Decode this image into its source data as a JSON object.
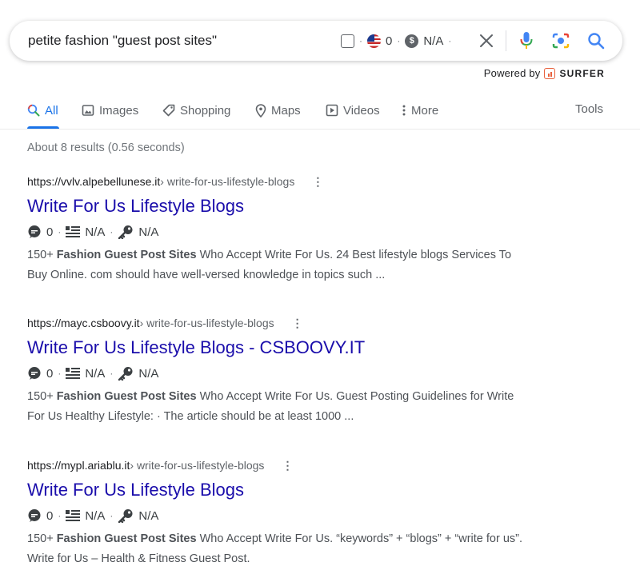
{
  "search": {
    "query": "petite fashion \"guest post sites\"",
    "surfer_count": "0",
    "surfer_cpc": "N/A"
  },
  "powered_by": {
    "label": "Powered by",
    "brand": "SURFER"
  },
  "tabs": [
    {
      "label": "All",
      "icon": "search-icon",
      "active": true
    },
    {
      "label": "Images",
      "icon": "image-icon"
    },
    {
      "label": "Shopping",
      "icon": "tag-icon"
    },
    {
      "label": "Maps",
      "icon": "map-pin-icon"
    },
    {
      "label": "Videos",
      "icon": "play-icon"
    },
    {
      "label": "More",
      "icon": "more-vert-icon"
    }
  ],
  "tools_label": "Tools",
  "stats": "About 8 results (0.56 seconds)",
  "results": [
    {
      "domain": "https://vvlv.alpebellunese.it",
      "path": " › write-for-us-lifestyle-blogs",
      "title": "Write For Us Lifestyle Blogs",
      "comments": "0",
      "words": "N/A",
      "keywords": "N/A",
      "snippet_line1_pre": "150+ ",
      "snippet_line1_bold": "Fashion Guest Post Sites",
      "snippet_line1_post": " Who Accept Write For Us. 24 Best lifestyle blogs Services To",
      "snippet_line2": "Buy Online. com should have well-versed knowledge in topics such ..."
    },
    {
      "domain": "https://mayc.csboovy.it",
      "path": " › write-for-us-lifestyle-blogs",
      "title": "Write For Us Lifestyle Blogs - CSBOOVY.IT",
      "comments": "0",
      "words": "N/A",
      "keywords": "N/A",
      "snippet_line1_pre": "150+ ",
      "snippet_line1_bold": "Fashion Guest Post Sites",
      "snippet_line1_post": " Who Accept Write For Us. Guest Posting Guidelines for Write",
      "snippet_line2": "For Us Healthy Lifestyle: · The article should be at least 1000 ..."
    },
    {
      "domain": "https://mypl.ariablu.it",
      "path": " › write-for-us-lifestyle-blogs",
      "title": "Write For Us Lifestyle Blogs",
      "comments": "0",
      "words": "N/A",
      "keywords": "N/A",
      "snippet_line1_pre": "150+ ",
      "snippet_line1_bold": "Fashion Guest Post Sites",
      "snippet_line1_post": " Who Accept Write For Us. “keywords” + “blogs” + “write for us”.",
      "snippet_line2": "Write for Us – Health & Fitness Guest Post."
    }
  ],
  "colors": {
    "link": "#1a0dab",
    "accent": "#1a73e8",
    "surfer": "#e8603c"
  }
}
